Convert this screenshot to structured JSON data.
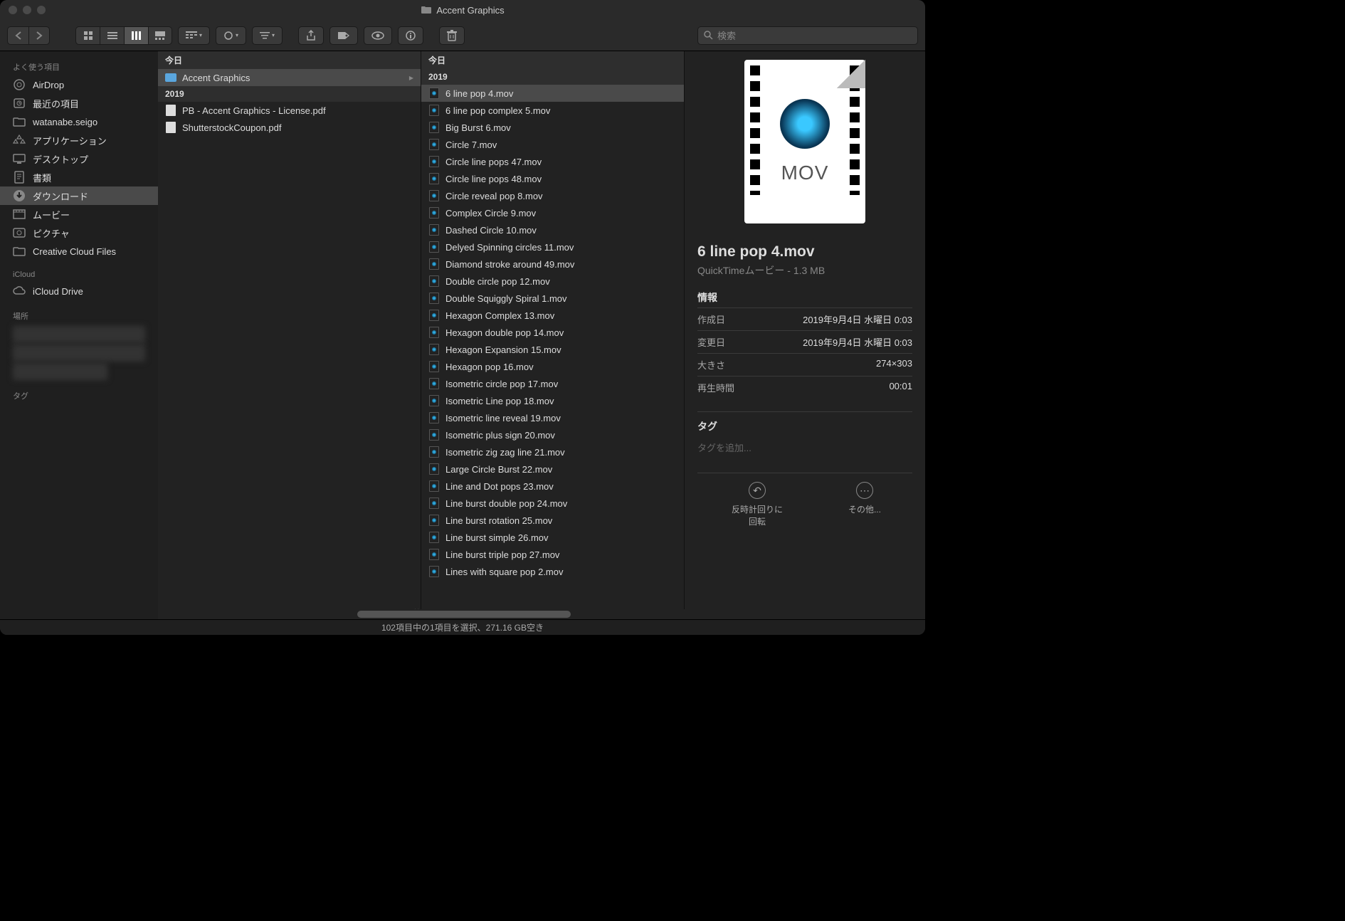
{
  "window": {
    "title": "Accent Graphics"
  },
  "search": {
    "placeholder": "検索"
  },
  "sidebar": {
    "favorites_header": "よく使う項目",
    "favorites": [
      {
        "label": "AirDrop",
        "icon": "airdrop"
      },
      {
        "label": "最近の項目",
        "icon": "clock"
      },
      {
        "label": "watanabe.seigo",
        "icon": "folder"
      },
      {
        "label": "アプリケーション",
        "icon": "apps"
      },
      {
        "label": "デスクトップ",
        "icon": "desktop"
      },
      {
        "label": "書類",
        "icon": "docs"
      },
      {
        "label": "ダウンロード",
        "icon": "downloads",
        "selected": true
      },
      {
        "label": "ムービー",
        "icon": "movies"
      },
      {
        "label": "ピクチャ",
        "icon": "pictures"
      },
      {
        "label": "Creative Cloud Files",
        "icon": "folder"
      }
    ],
    "icloud_header": "iCloud",
    "icloud": [
      {
        "label": "iCloud Drive",
        "icon": "cloud"
      }
    ],
    "locations_header": "場所",
    "tags_header": "タグ"
  },
  "column1": {
    "group1": "今日",
    "items1": [
      {
        "label": "Accent Graphics",
        "type": "folder",
        "selected": true
      }
    ],
    "group2": "2019",
    "items2": [
      {
        "label": "PB - Accent Graphics - License.pdf",
        "type": "pdf"
      },
      {
        "label": "ShutterstockCoupon.pdf",
        "type": "pdf"
      }
    ]
  },
  "column2": {
    "group1": "今日",
    "group2": "2019",
    "items": [
      {
        "label": "6 line pop 4.mov",
        "selected": true
      },
      {
        "label": "6 line pop complex 5.mov"
      },
      {
        "label": "Big Burst 6.mov"
      },
      {
        "label": "Circle 7.mov"
      },
      {
        "label": "Circle line pops 47.mov"
      },
      {
        "label": "Circle line pops 48.mov"
      },
      {
        "label": "Circle reveal pop 8.mov"
      },
      {
        "label": "Complex Circle 9.mov"
      },
      {
        "label": "Dashed Circle 10.mov"
      },
      {
        "label": "Delyed Spinning circles 11.mov"
      },
      {
        "label": "Diamond stroke around 49.mov"
      },
      {
        "label": "Double circle pop 12.mov"
      },
      {
        "label": "Double Squiggly Spiral 1.mov"
      },
      {
        "label": "Hexagon Complex 13.mov"
      },
      {
        "label": "Hexagon double pop 14.mov"
      },
      {
        "label": "Hexagon Expansion 15.mov"
      },
      {
        "label": "Hexagon pop 16.mov"
      },
      {
        "label": "Isometric circle pop 17.mov"
      },
      {
        "label": "Isometric Line pop 18.mov"
      },
      {
        "label": "Isometric line reveal 19.mov"
      },
      {
        "label": "Isometric plus sign 20.mov"
      },
      {
        "label": "Isometric zig zag line 21.mov"
      },
      {
        "label": "Large Circle Burst  22.mov"
      },
      {
        "label": "Line and Dot pops 23.mov"
      },
      {
        "label": "Line burst double pop 24.mov"
      },
      {
        "label": "Line burst rotation 25.mov"
      },
      {
        "label": "Line burst simple 26.mov"
      },
      {
        "label": "Line burst triple pop 27.mov"
      },
      {
        "label": "Lines with square pop 2.mov"
      }
    ]
  },
  "preview": {
    "thumb_label": "MOV",
    "filename": "6 line pop 4.mov",
    "subtitle": "QuickTimeムービー - 1.3 MB",
    "info_header": "情報",
    "rows": [
      {
        "label": "作成日",
        "value": "2019年9月4日 水曜日 0:03"
      },
      {
        "label": "変更日",
        "value": "2019年9月4日 水曜日 0:03"
      },
      {
        "label": "大きさ",
        "value": "274×303"
      },
      {
        "label": "再生時間",
        "value": "00:01"
      }
    ],
    "tags_header": "タグ",
    "tags_placeholder": "タグを追加...",
    "action_rotate": "反時計回りに回転",
    "action_more": "その他..."
  },
  "status": "102項目中の1項目を選択、271.16 GB空き"
}
